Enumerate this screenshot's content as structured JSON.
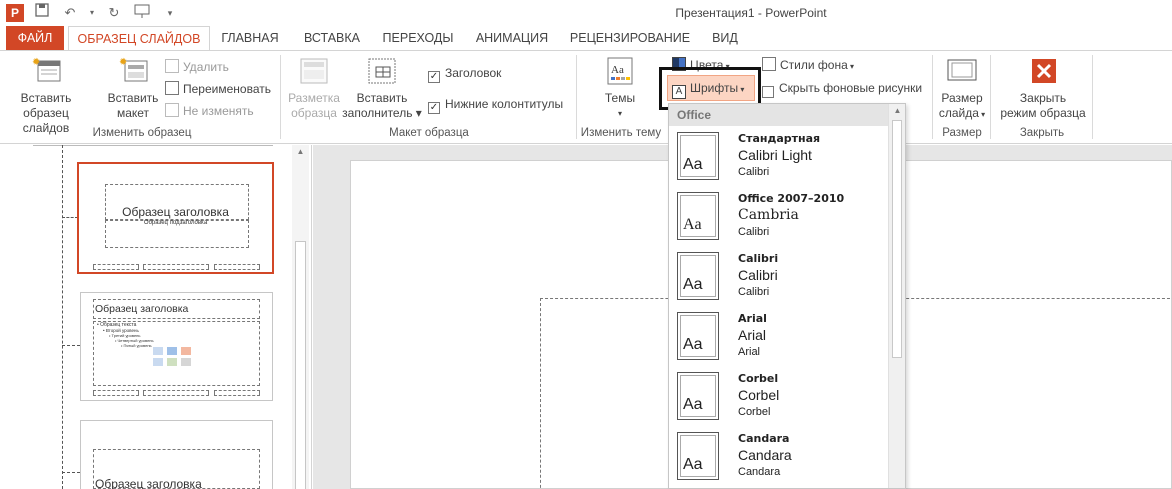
{
  "window": {
    "title": "Презентация1 - PowerPoint"
  },
  "qat": {
    "app_icon": "P"
  },
  "tabs": [
    "ФАЙЛ",
    "ОБРАЗЕЦ СЛАЙДОВ",
    "ГЛАВНАЯ",
    "ВСТАВКА",
    "ПЕРЕХОДЫ",
    "АНИМАЦИЯ",
    "РЕЦЕНЗИРОВАНИЕ",
    "ВИД"
  ],
  "ribbon": {
    "edit_master": {
      "label": "Изменить образец",
      "insert_master": [
        "Вставить",
        "образец слайдов"
      ],
      "insert_layout": [
        "Вставить",
        "макет"
      ],
      "delete": "Удалить",
      "rename": "Переименовать",
      "preserve": "Не изменять"
    },
    "master_layout": {
      "label": "Макет образца",
      "master_layout_btn": [
        "Разметка",
        "образца"
      ],
      "insert_placeholder": [
        "Вставить",
        "заполнитель ▾"
      ],
      "title_chk": "Заголовок",
      "footers_chk": "Нижние колонтитулы"
    },
    "edit_theme": {
      "label": "Изменить тему",
      "themes": "Темы",
      "colors": "Цвета",
      "fonts": "Шрифты",
      "bg_styles": "Стили фона",
      "hide_bg": "Скрыть фоновые рисунки"
    },
    "size": {
      "label": "Размер",
      "btn": [
        "Размер",
        "слайда"
      ]
    },
    "close": {
      "label": "Закрыть",
      "btn": [
        "Закрыть",
        "режим образца"
      ]
    }
  },
  "thumbnails": {
    "title_text": "Образец заголовка",
    "subtitle_text": "Образец подзаголовка",
    "body_lines": [
      "• Образец текста",
      "• Второй уровень",
      "• Третий уровень",
      "• Четвертый уровень",
      "• Пятый уровень"
    ]
  },
  "fonts_dropdown": {
    "header": "Office",
    "items": [
      {
        "name": "Стандартная",
        "heading": "Calibri Light",
        "body": "Calibri"
      },
      {
        "name": "Office 2007–2010",
        "heading": "Cambria",
        "body": "Calibri"
      },
      {
        "name": "Calibri",
        "heading": "Calibri",
        "body": "Calibri"
      },
      {
        "name": "Arial",
        "heading": "Arial",
        "body": "Arial"
      },
      {
        "name": "Corbel",
        "heading": "Corbel",
        "body": "Corbel"
      },
      {
        "name": "Candara",
        "heading": "Candara",
        "body": "Candara"
      }
    ],
    "preview_glyph": "Aa"
  }
}
